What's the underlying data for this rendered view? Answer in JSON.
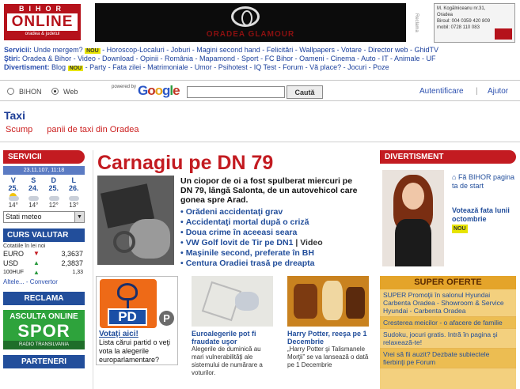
{
  "header": {
    "logo_top": "BIHOR",
    "logo_main": "ONLINE",
    "logo_sub": "oradea & judetul",
    "banner_text": "ORADEA GLAMOUR",
    "publicitate": "Reclama",
    "contact_lines": [
      "M. Kogălniceanu nr.31,",
      "Oradea",
      "Biroul: 004 0359 420 809",
      "mobil: 0728 110 083"
    ]
  },
  "nav": {
    "rows": [
      {
        "label": "Servicii:",
        "items": [
          "Unde mergem?",
          "Horoscop-Localuri",
          "Joburi",
          "Magini second hand",
          "Felicitări",
          "Wallpapers",
          "Votare",
          "Director web",
          "GhidTV"
        ],
        "new_after": 0
      },
      {
        "label": "Ştiri:",
        "items": [
          "Oradea & Bihor",
          "Video",
          "Download",
          "Opinii",
          "România",
          "Mapamond",
          "Sport",
          "FC Bihor",
          "Oameni",
          "Cinema",
          "Auto",
          "IT",
          "Animale",
          "UF"
        ],
        "new_after": -1
      },
      {
        "label": "Divertisment:",
        "items": [
          "Blog",
          "Party",
          "Fata zilei",
          "Matrimoniale",
          "Umor",
          "Psihotest",
          "IQ Test",
          "Forum",
          "Vă place?",
          "Jocuri",
          "Poze"
        ],
        "new_after": 0
      }
    ],
    "new_badge": "NOU"
  },
  "search": {
    "opt_site": "BIHON",
    "opt_web": "Web",
    "powered_by": "powered by",
    "google": [
      "G",
      "o",
      "o",
      "g",
      "l",
      "e"
    ],
    "input_value": "",
    "button_label": "Caută",
    "auth_link": "Autentificare",
    "separator": "|",
    "help_link": "Ajutor"
  },
  "taxi": {
    "title": "Taxi",
    "sub_items": [
      "Scump",
      "panii de taxi din Oradea"
    ]
  },
  "left": {
    "servicii_label": "SERVICII",
    "date_line": "23.11.107, 11:18",
    "weather": [
      {
        "day": "V",
        "date": "25.",
        "temp": "14°",
        "icon": "sun-icon"
      },
      {
        "day": "S",
        "date": "24.",
        "temp": "14°",
        "icon": "cloud-icon"
      },
      {
        "day": "D",
        "date": "25.",
        "temp": "12°",
        "icon": "cloud-icon"
      },
      {
        "day": "L",
        "date": "26.",
        "temp": "13°",
        "icon": "cloud-icon"
      }
    ],
    "meteo_select": "Stati meteo",
    "valutar_label": "CURS VALUTAR",
    "valutar_caption": "Cotatiile în lei noi",
    "rates": [
      {
        "currency": "EURO",
        "dir": "down",
        "value": "3,3637"
      },
      {
        "currency": "USD",
        "dir": "up",
        "value": "2,3837"
      },
      {
        "currency": "100HUF",
        "dir": "up",
        "value": "1,33"
      }
    ],
    "valutar_links": "Altele... - Convertor",
    "reclama_label": "RECLAMA",
    "asculta_top": "ASCULTA ONLINE",
    "asculta_main": "SPOR",
    "asculta_bottom": "RADIO TRANSILVANIA",
    "parteneri_label": "PARTENERI"
  },
  "center": {
    "headline": "Carnagiu pe DN 79",
    "lead_text": "Un ciopor de oi a fost spulberat miercuri pe DN 79, lângă Salonta, de un autovehicol care gonea spre Arad.",
    "bullets": [
      "Orădeni accidentaţi grav",
      "Accidentaţi mortal după o criză",
      "Doua crime în aceeasi seara",
      "VW Golf lovit de Tir pe DN1",
      "Maşinile second, preferate în BH",
      "Centura Oradiei trasă pe dreapta"
    ],
    "bullet_video": "| Video",
    "promo": {
      "logo_text": "PD",
      "badge": "P",
      "title": "Votaţi aici!",
      "text": "Lista cărui partid o veţi vota la alegerile europarlamentare?"
    },
    "stories": [
      {
        "title": "Euroalegerile pot fi fraudate uşor",
        "body": "Alegerile de duminică au mari vulnerabilităţi ale sistemului de numărare a voturilor."
      },
      {
        "title": "Harry Potter, reeşa pe 1 Decembrie",
        "body": "„Harry Potter şi Talismanele Morţii” se va lansează o dată pe 1 Decembrie"
      }
    ]
  },
  "right": {
    "divertisment_label": "DIVERTISMENT",
    "links": [
      "Fă BIHOR pagina ta de start"
    ],
    "vote_title": "Votează fata lunii octombrie",
    "new_badge": "NOU",
    "super_label": "SUPER OFERTE",
    "offers": [
      "SUPER Promoţii în salonul Hyundai Carbenta Oradea - Showroom & Service Hyundai - Carbenta Oradea",
      "Cresterea meicilor - o afacere de familie",
      "Sudoku, jocuri gratis. Intră în pagina şi relaxează-te!",
      "Vrei să fii auzit? Dezbate subiectele fierbinţi pe Forum"
    ]
  },
  "colors": {
    "brand_red": "#c31b21",
    "brand_blue": "#224e9b",
    "new_yellow": "#e7e400"
  }
}
